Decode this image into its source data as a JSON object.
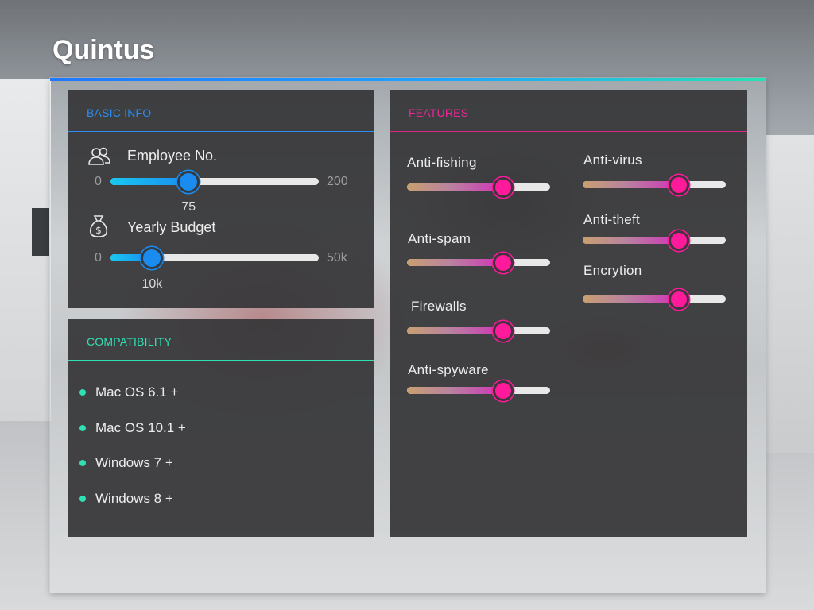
{
  "app": {
    "title": "Quintus"
  },
  "basic_info": {
    "header": "BASIC INFO",
    "employee": {
      "icon": "people-icon",
      "label": "Employee No.",
      "min_label": "0",
      "max_label": "200",
      "min": 0,
      "max": 200,
      "value": 75,
      "value_label": "75"
    },
    "budget": {
      "icon": "money-bag-icon",
      "label": "Yearly Budget",
      "min_label": "0",
      "max_label": "50k",
      "min": 0,
      "max": 50,
      "value": 10,
      "value_label": "10k"
    },
    "accent": "#2d8df0"
  },
  "compatibility": {
    "header": "COMPATIBILITY",
    "items": [
      "Mac OS 6.1 +",
      "Mac OS 10.1 +",
      "Windows 7 +",
      "Windows 8 +"
    ],
    "accent": "#2ee0b2"
  },
  "features": {
    "header": "FEATURES",
    "accent": "#f0259a",
    "items": [
      {
        "label": "Anti-fishing",
        "level": 0.67
      },
      {
        "label": "Anti-spam",
        "level": 0.67
      },
      {
        "label": "Firewalls",
        "level": 0.67
      },
      {
        "label": "Anti-spyware",
        "level": 0.67
      },
      {
        "label": "Anti-virus",
        "level": 0.67
      },
      {
        "label": "Anti-theft",
        "level": 0.67
      },
      {
        "label": "Encrytion",
        "level": 0.67
      }
    ]
  }
}
